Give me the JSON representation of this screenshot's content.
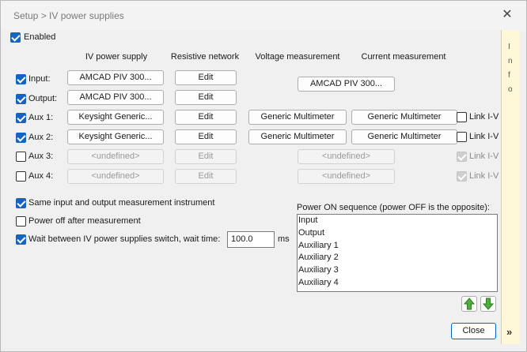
{
  "window": {
    "title": "Setup > IV power supplies",
    "close_glyph": "✕"
  },
  "enabled": {
    "label": "Enabled",
    "checked": true
  },
  "columns": {
    "iv": "IV power supply",
    "resistive": "Resistive network",
    "voltage": "Voltage measurement",
    "current": "Current measurement"
  },
  "rows": [
    {
      "label": "Input:",
      "checked": true,
      "iv": "AMCAD PIV 300...",
      "res": "Edit",
      "volt": "AMCAD PIV 300...",
      "curr": "",
      "link": ""
    },
    {
      "label": "Output:",
      "checked": true,
      "iv": "AMCAD PIV 300...",
      "res": "Edit",
      "volt": "",
      "curr": "",
      "link": ""
    },
    {
      "label": "Aux 1:",
      "checked": true,
      "iv": "Keysight Generic...",
      "res": "Edit",
      "volt": "Generic Multimeter",
      "curr": "Generic Multimeter",
      "link": "Link I-V"
    },
    {
      "label": "Aux 2:",
      "checked": true,
      "iv": "Keysight Generic...",
      "res": "Edit",
      "volt": "Generic Multimeter",
      "curr": "Generic Multimeter",
      "link": "Link I-V"
    },
    {
      "label": "Aux 3:",
      "checked": false,
      "iv": "<undefined>",
      "res": "Edit",
      "volt": "<undefined>",
      "curr": "",
      "link": "Link I-V"
    },
    {
      "label": "Aux 4:",
      "checked": false,
      "iv": "<undefined>",
      "res": "Edit",
      "volt": "<undefined>",
      "curr": "",
      "link": "Link I-V"
    }
  ],
  "options": {
    "same_instrument": {
      "label": "Same input and output measurement instrument",
      "checked": true
    },
    "power_off": {
      "label": "Power off after measurement",
      "checked": false
    },
    "wait": {
      "label": "Wait between IV power supplies switch, wait time:",
      "checked": true,
      "value": "100.0",
      "unit": "ms"
    }
  },
  "sequence": {
    "title": "Power ON sequence (power OFF is the opposite):",
    "items": [
      "Input",
      "Output",
      "Auxiliary 1",
      "Auxiliary 2",
      "Auxiliary 3",
      "Auxiliary 4"
    ]
  },
  "footer": {
    "close_label": "Close"
  },
  "side_panel": {
    "letters": [
      "I",
      "n",
      "f",
      "o"
    ],
    "chevron": "»"
  },
  "colors": {
    "accent": "#1565c0",
    "arrow_green": "#3a9a2a"
  }
}
